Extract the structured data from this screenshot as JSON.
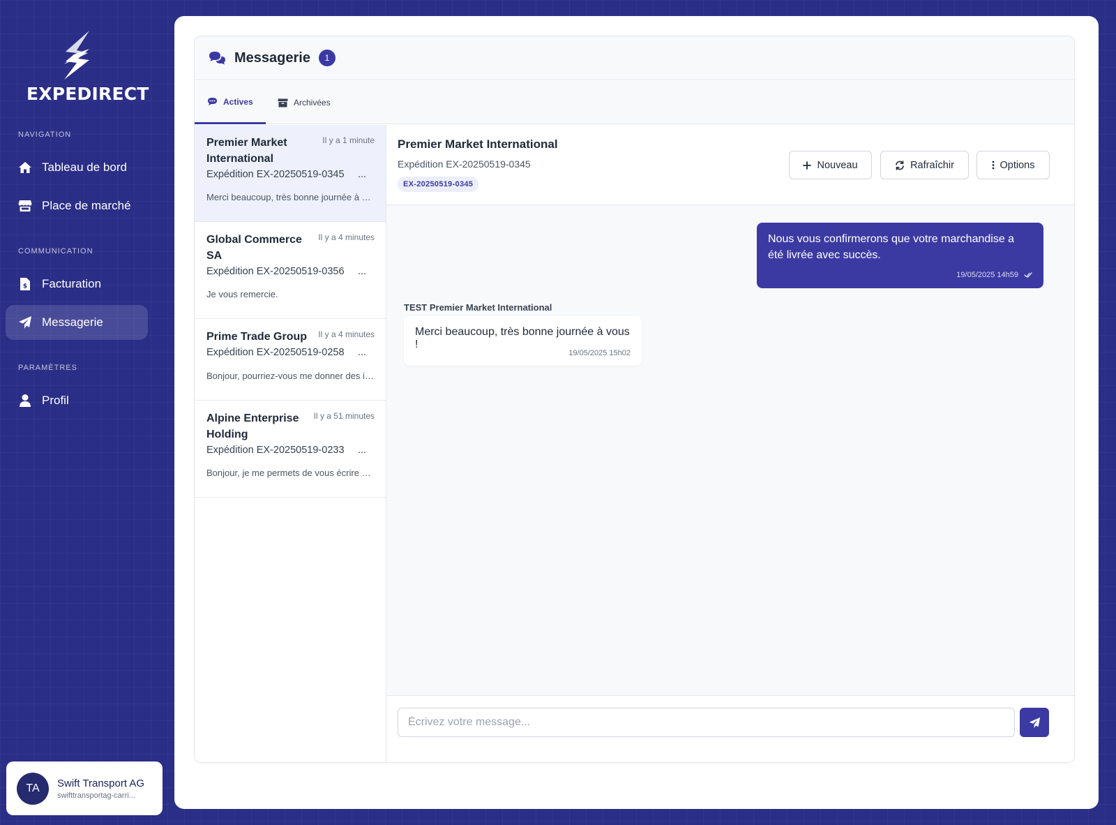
{
  "brand": {
    "name": "EXPEDIRECT",
    "logo_icon": "bolt-logo-icon"
  },
  "sidebar": {
    "sections": [
      {
        "label": "NAVIGATION"
      },
      {
        "label": "COMMUNICATION"
      },
      {
        "label": "PARAMÈTRES"
      }
    ],
    "items": [
      {
        "label": "Tableau de bord",
        "icon": "home-icon"
      },
      {
        "label": "Place de marché",
        "icon": "store-icon"
      },
      {
        "label": "Facturation",
        "icon": "invoice-icon"
      },
      {
        "label": "Messagerie",
        "icon": "paper-plane-icon",
        "active": true
      },
      {
        "label": "Profil",
        "icon": "user-icon"
      }
    ]
  },
  "user": {
    "initials": "TA",
    "name": "Swift Transport AG",
    "email": "swifttransportag-carri..."
  },
  "messaging": {
    "title": "Messagerie",
    "unread_count": "1",
    "tabs": [
      {
        "label": "Actives",
        "icon": "chat-icon",
        "active": true
      },
      {
        "label": "Archivées",
        "icon": "archive-icon"
      }
    ],
    "conversations": [
      {
        "name": "Premier Market International",
        "time": "Il y a 1 minute",
        "shipment": "Expédition EX-20250519-0345",
        "preview": "Merci beaucoup, très bonne journée à vous !",
        "active": true
      },
      {
        "name": "Global Commerce SA",
        "time": "Il y a 4 minutes",
        "shipment": "Expédition EX-20250519-0356",
        "preview": "Je vous remercie."
      },
      {
        "name": "Prime Trade Group",
        "time": "Il y a 4 minutes",
        "shipment": "Expédition EX-20250519-0258",
        "preview": "Bonjour, pourriez-vous me donner des informations"
      },
      {
        "name": "Alpine Enterprise Holding",
        "time": "Il y a 51 minutes",
        "shipment": "Expédition EX-20250519-0233",
        "preview": "Bonjour, je me permets de vous écrire concernant"
      }
    ],
    "ellipsis": "...",
    "detail": {
      "title": "Premier Market International",
      "subtitle": "Expédition EX-20250519-0345",
      "tag": "EX-20250519-0345",
      "buttons": {
        "new": "Nouveau",
        "refresh": "Rafraîchir",
        "options": "Options"
      },
      "messages": [
        {
          "direction": "out",
          "text": "Nous vous confirmerons que votre marchandise a été livrée avec succès.",
          "timestamp": "19/05/2025 14h59",
          "status_icon": "double-check-icon"
        },
        {
          "direction": "in",
          "sender": "TEST Premier Market International",
          "text": "Merci beaucoup, très bonne journée à vous !",
          "timestamp": "19/05/2025 15h02"
        }
      ],
      "composer": {
        "placeholder": "Écrivez votre message...",
        "value": ""
      }
    }
  },
  "colors": {
    "background": "#2a2e86",
    "accent": "#3b3aa3",
    "surface": "#ffffff"
  }
}
